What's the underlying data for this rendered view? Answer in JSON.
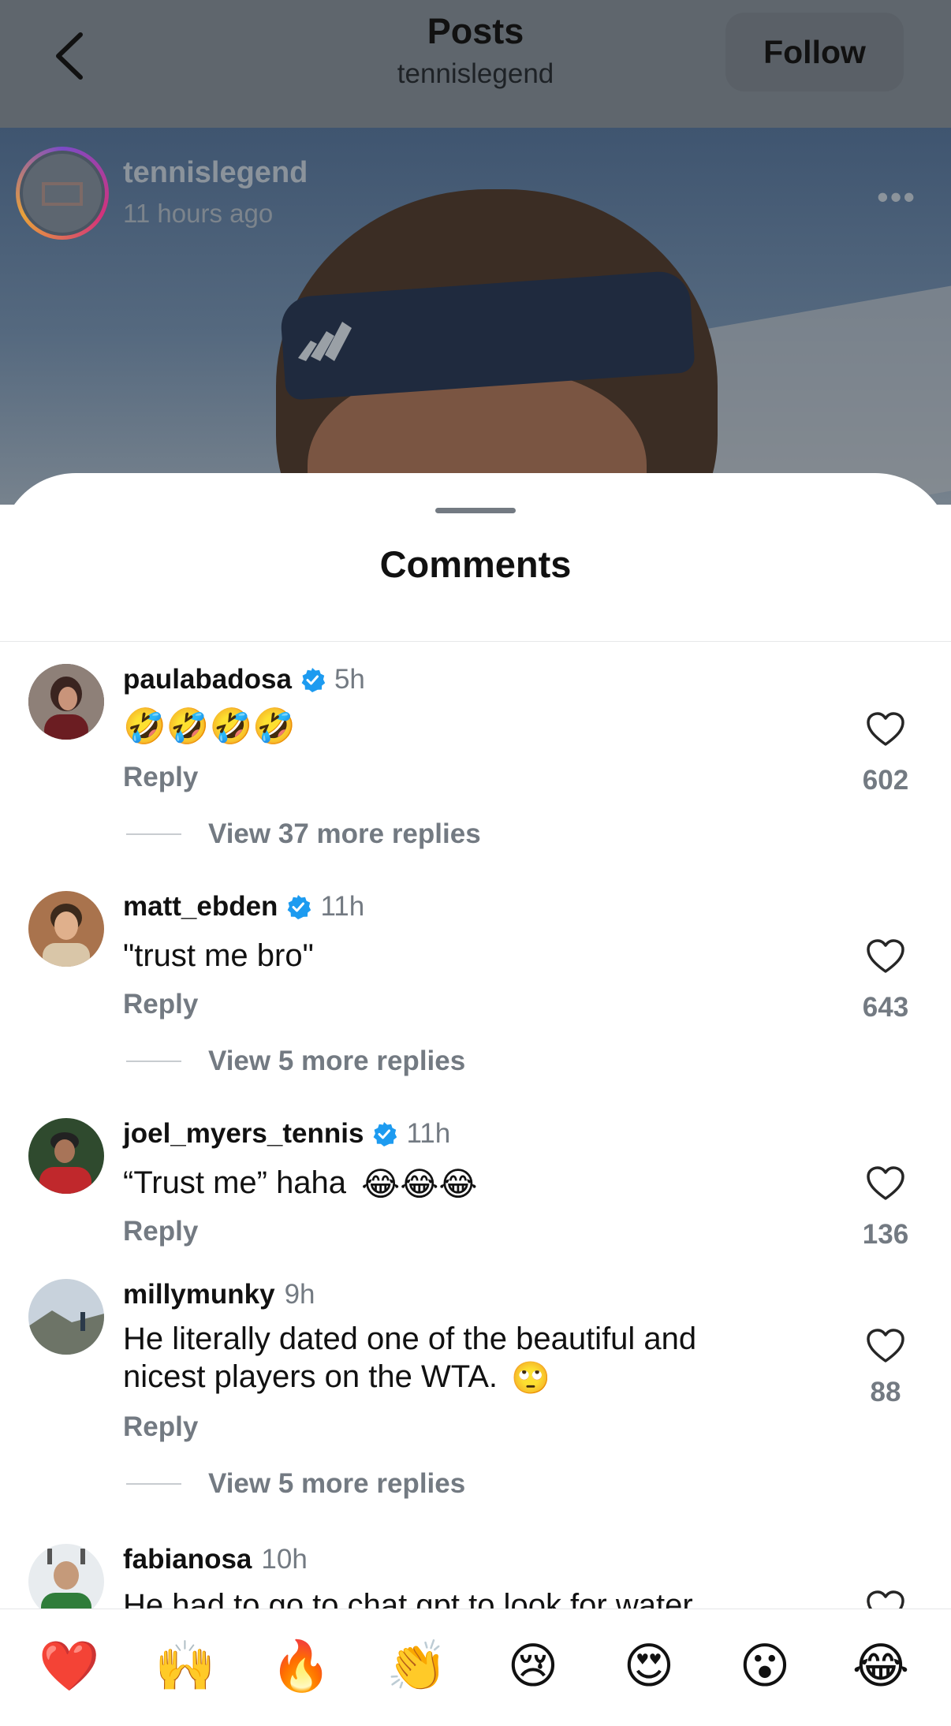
{
  "header": {
    "title": "Posts",
    "subtitle": "tennislegend",
    "follow_label": "Follow"
  },
  "post": {
    "username": "tennislegend",
    "time": "11 hours ago",
    "more": "•••"
  },
  "sheet": {
    "title": "Comments"
  },
  "comments": [
    {
      "user": "paulabadosa",
      "verified": true,
      "time": "5h",
      "text": "🤣🤣🤣🤣",
      "reply": "Reply",
      "likes": "602",
      "view_more": "View 37 more replies"
    },
    {
      "user": "matt_ebden",
      "verified": true,
      "time": "11h",
      "text": "\"trust me bro\"",
      "reply": "Reply",
      "likes": "643",
      "view_more": "View 5 more replies"
    },
    {
      "user": "joel_myers_tennis",
      "verified": true,
      "time": "11h",
      "text": "“Trust me” haha",
      "reply": "Reply",
      "likes": "136"
    },
    {
      "user": "millymunky",
      "verified": false,
      "time": "9h",
      "text_line1": "He literally dated one of the beautiful and",
      "text_line2": "nicest players on the WTA.",
      "reply": "Reply",
      "likes": "88",
      "view_more": "View 5 more replies"
    },
    {
      "user": "fabianosa",
      "verified": false,
      "time": "10h",
      "text": "He had to go to chat gpt to look for water"
    }
  ],
  "reactions": [
    "❤️",
    "🙌",
    "🔥",
    "👏",
    "😢",
    "😍",
    "😮",
    "😂"
  ],
  "colors": {
    "verified": "#1d9bf0",
    "muted": "#737a82",
    "heart_red": "#e0202a"
  }
}
